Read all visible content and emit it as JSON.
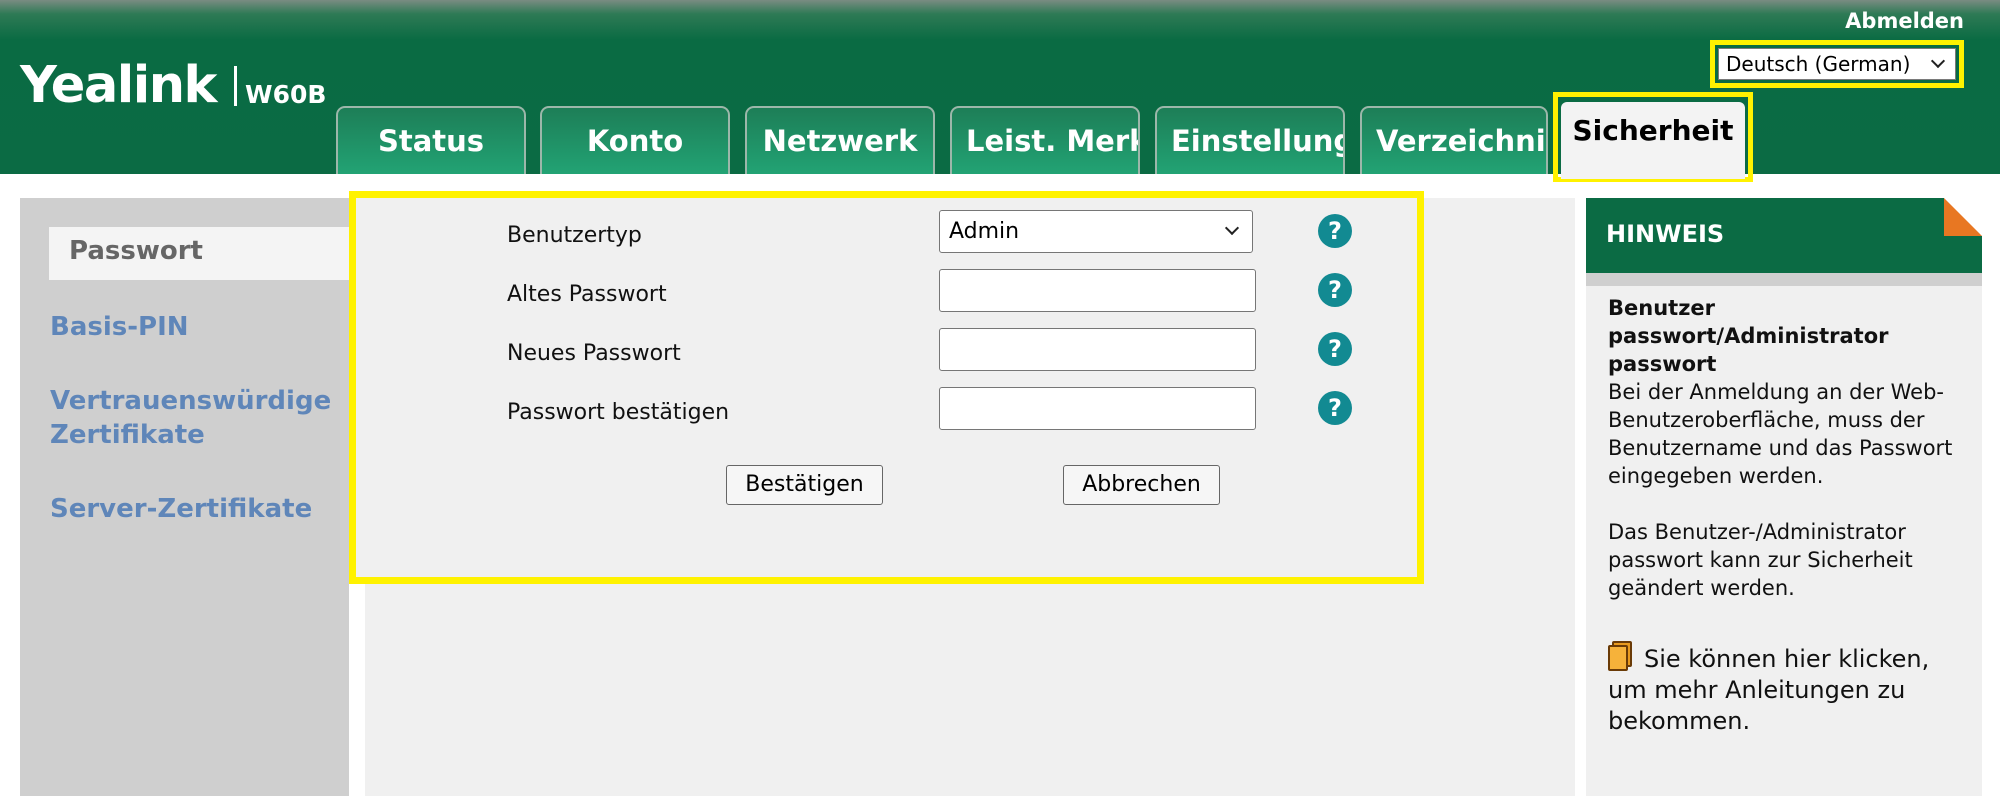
{
  "header": {
    "logout": "Abmelden",
    "brand": "Yealink",
    "model": "W60B",
    "language": "Deutsch (German)"
  },
  "tabs": [
    {
      "label": "Status"
    },
    {
      "label": "Konto"
    },
    {
      "label": "Netzwerk"
    },
    {
      "label": "Leist. Merkmale"
    },
    {
      "label": "Einstellungen"
    },
    {
      "label": "Verzeichnis"
    },
    {
      "label": "Sicherheit",
      "active": true
    }
  ],
  "sidebar": {
    "items": [
      {
        "label": "Passwort",
        "active": true
      },
      {
        "label": "Basis-PIN"
      },
      {
        "label": "Vertrauenswürdige"
      },
      {
        "label": "Zertifikate"
      },
      {
        "label": "Server-Zertifikate"
      }
    ]
  },
  "form": {
    "user_type_label": "Benutzertyp",
    "user_type_value": "Admin",
    "old_password_label": "Altes Passwort",
    "new_password_label": "Neues Passwort",
    "confirm_password_label": "Passwort bestätigen",
    "help_glyph": "?",
    "confirm_button": "Bestätigen",
    "cancel_button": "Abbrechen"
  },
  "hint": {
    "title": "HINWEIS",
    "heading_line1": "Benutzer",
    "heading_line2": "passwort/Administrator",
    "heading_line3": "passwort",
    "para1": "Bei der Anmeldung an der Web-Benutzeroberfläche, muss der Benutzername und das Passwort eingegeben werden.",
    "para2": "Das Benutzer-/Administrator passwort kann zur Sicherheit geändert werden.",
    "link_text": "Sie können hier klicken, um mehr Anleitungen zu bekommen."
  },
  "colors": {
    "header_green": "#0b6b44",
    "tab_green": "#22a374",
    "highlight_yellow": "#fff200",
    "sidebar_link_blue": "#5f86b9",
    "help_teal": "#128a92",
    "hint_corner_orange": "#e87722"
  }
}
